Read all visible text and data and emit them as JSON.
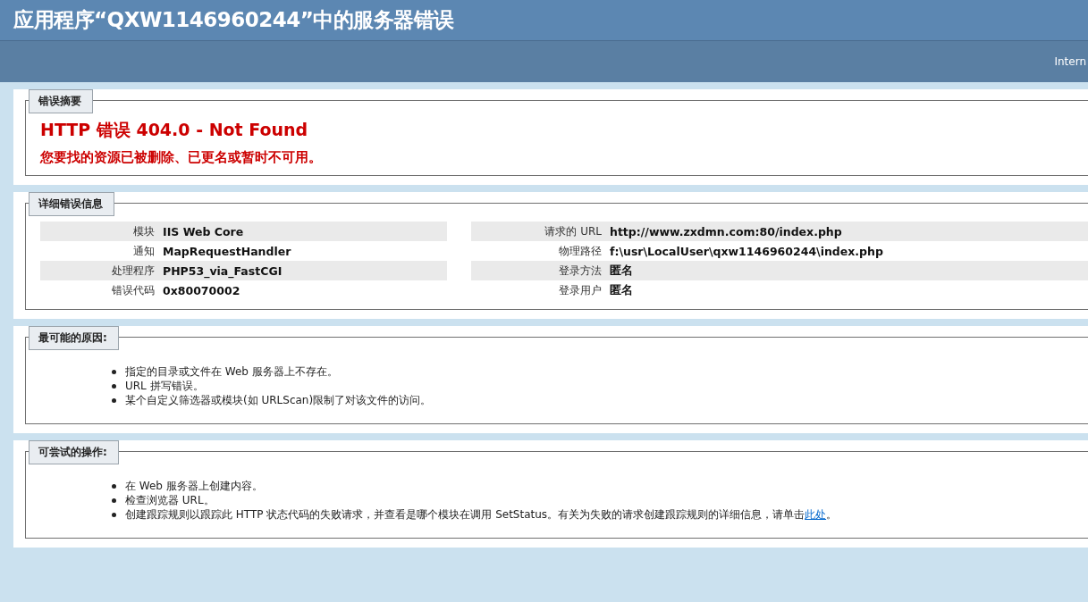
{
  "header": {
    "title": "应用程序“QXW1146960244”中的服务器错误",
    "subtitle": "Intern"
  },
  "summary": {
    "legend": "错误摘要",
    "heading": "HTTP 错误 404.0 - Not Found",
    "message": "您要找的资源已被删除、已更名或暂时不可用。"
  },
  "details": {
    "legend": "详细错误信息",
    "left": [
      {
        "label": "模块",
        "value": "IIS Web Core"
      },
      {
        "label": "通知",
        "value": "MapRequestHandler"
      },
      {
        "label": "处理程序",
        "value": "PHP53_via_FastCGI"
      },
      {
        "label": "错误代码",
        "value": "0x80070002"
      }
    ],
    "right": [
      {
        "label": "请求的 URL",
        "value": "http://www.zxdmn.com:80/index.php"
      },
      {
        "label": "物理路径",
        "value": "f:\\usr\\LocalUser\\qxw1146960244\\index.php"
      },
      {
        "label": "登录方法",
        "value": "匿名"
      },
      {
        "label": "登录用户",
        "value": "匿名"
      }
    ]
  },
  "causes": {
    "legend": "最可能的原因:",
    "items": [
      {
        "text": "指定的目录或文件在 Web 服务器上不存在。"
      },
      {
        "text": "URL 拼写错误。"
      },
      {
        "text": "某个自定义筛选器或模块(如 URLScan)限制了对该文件的访问。"
      }
    ]
  },
  "actions": {
    "legend": "可尝试的操作:",
    "items": [
      {
        "text": "在 Web 服务器上创建内容。"
      },
      {
        "text": "检查浏览器 URL。"
      },
      {
        "text": "创建跟踪规则以跟踪此 HTTP 状态代码的失败请求，并查看是哪个模块在调用 SetStatus。有关为失败的请求创建跟踪规则的详细信息，请单击",
        "link": "此处",
        "after": "。"
      }
    ]
  }
}
